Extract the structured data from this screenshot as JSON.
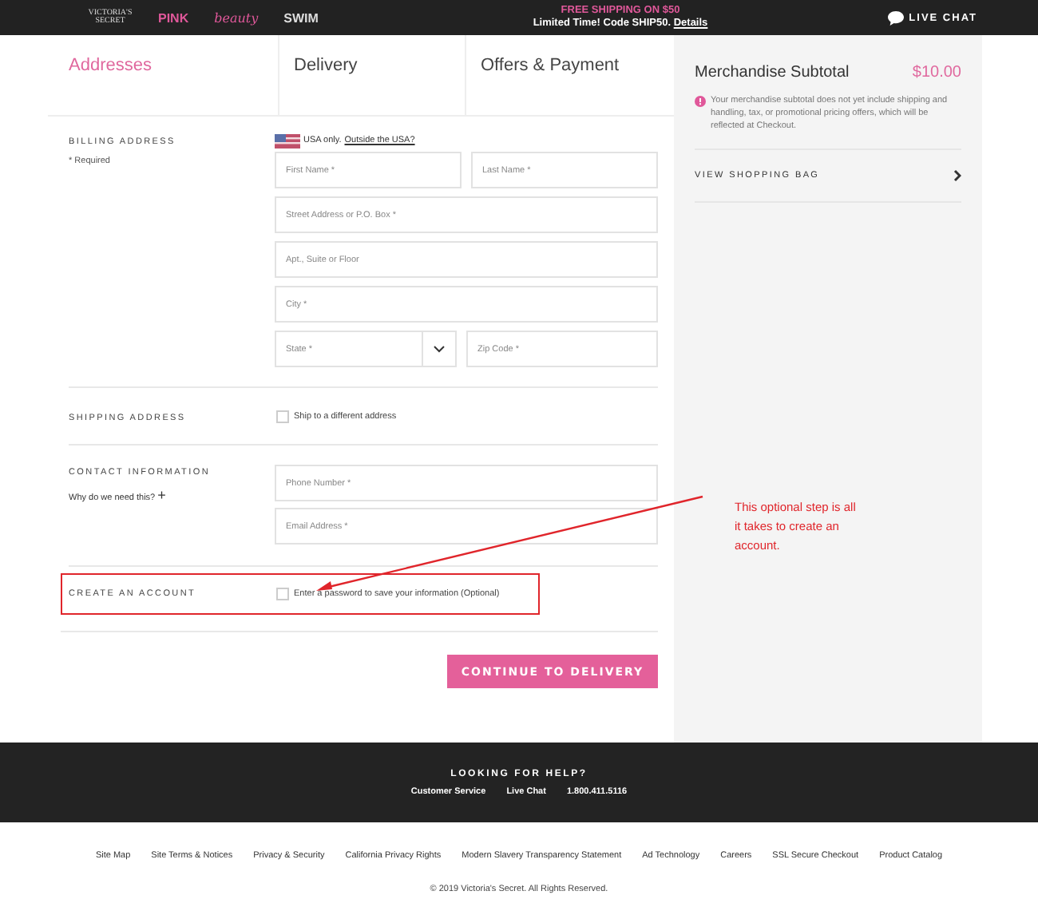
{
  "top_bar": {
    "brands": [
      {
        "kind": "serif",
        "label": "VICTORIA'S SECRET"
      },
      {
        "kind": "pink",
        "label": "PINK"
      },
      {
        "kind": "script",
        "label": "beauty"
      },
      {
        "kind": "bold",
        "label": "SWIM"
      }
    ],
    "promo_headline": "FREE SHIPPING ON $50",
    "promo_text": "Limited Time! Code SHIP50.",
    "promo_link": "Details",
    "live_chat": "LIVE CHAT"
  },
  "tabs": [
    {
      "label": "Addresses",
      "selected": true
    },
    {
      "label": "Delivery",
      "selected": false
    },
    {
      "label": "Offers & Payment",
      "selected": false
    }
  ],
  "billing": {
    "title": "BILLING ADDRESS",
    "required": "* Required",
    "country_note": "USA only.",
    "country_link": "Outside the USA?",
    "field_rows": [
      [
        {
          "kind": "text",
          "placeholder": "First Name *"
        },
        {
          "kind": "text",
          "placeholder": "Last Name *"
        }
      ],
      [
        {
          "kind": "text",
          "placeholder": "Street Address or P.O. Box *"
        }
      ],
      [
        {
          "kind": "text",
          "placeholder": "Apt., Suite or Floor"
        }
      ],
      [
        {
          "kind": "text",
          "placeholder": "City *"
        }
      ],
      [
        {
          "kind": "select",
          "placeholder": "State *"
        },
        {
          "kind": "text",
          "placeholder": "Zip Code *"
        }
      ]
    ]
  },
  "shipping": {
    "title": "SHIPPING ADDRESS",
    "checkbox_label": "Ship to a different address",
    "checked": false
  },
  "contact": {
    "title": "CONTACT INFORMATION",
    "why": "Why do we need this?",
    "plus": "+",
    "fields": [
      {
        "placeholder": "Phone Number *"
      },
      {
        "placeholder": "Email Address *"
      }
    ]
  },
  "account": {
    "title": "CREATE AN ACCOUNT",
    "checkbox_label": "Enter a password to save your information (Optional)",
    "checked": false
  },
  "continue_button": "CONTINUE TO DELIVERY",
  "summary": {
    "label": "Merchandise Subtotal",
    "amount": "$10.00",
    "note": "Your merchandise subtotal does not yet include shipping and handling, tax, or promotional pricing offers, which will be reflected at Checkout.",
    "bag_link": "VIEW SHOPPING BAG"
  },
  "annotation": {
    "text": "This optional step is all it takes to create an account."
  },
  "help": {
    "title": "LOOKING FOR HELP?",
    "links": [
      "Customer Service",
      "Live Chat",
      "1.800.411.5116"
    ]
  },
  "footer_links": [
    "Site Map",
    "Site Terms & Notices",
    "Privacy & Security",
    "California Privacy Rights",
    "Modern Slavery Transparency Statement",
    "Ad Technology",
    "Careers",
    "SSL Secure Checkout",
    "Product Catalog"
  ],
  "copyright": "© 2019 Victoria's Secret. All Rights Reserved."
}
